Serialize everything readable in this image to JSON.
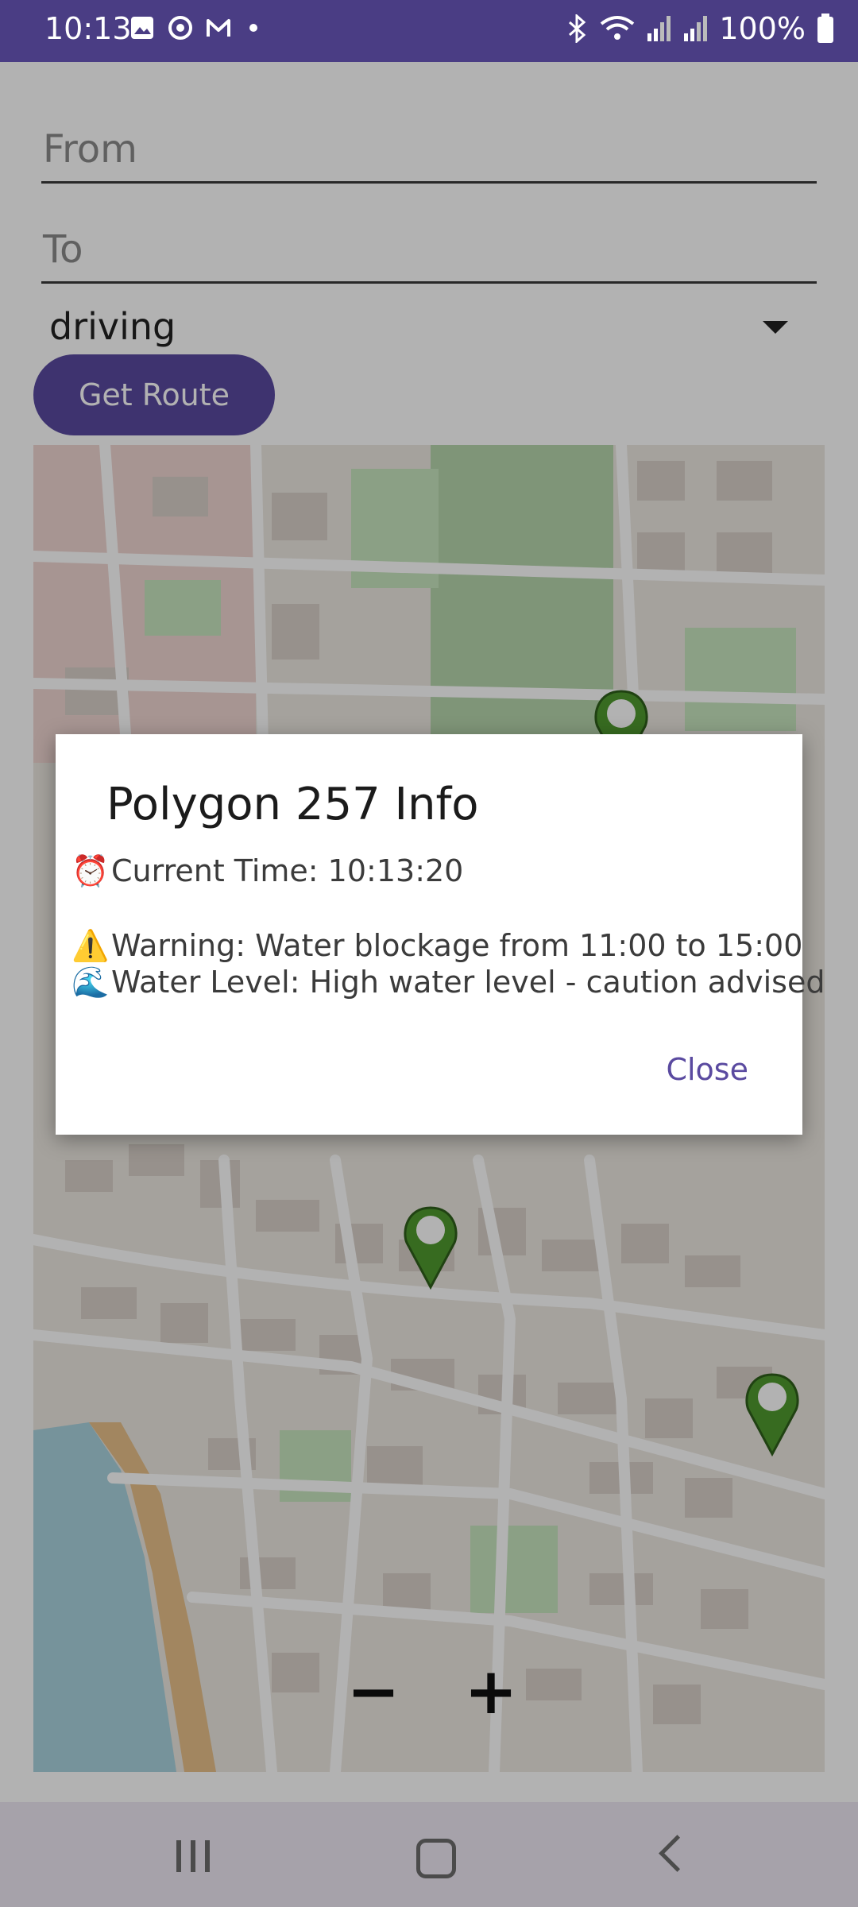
{
  "status_bar": {
    "time": "10:13",
    "battery": "100%",
    "left_icons": [
      "image-icon",
      "sync-icon",
      "gmail-icon",
      "dot-icon"
    ],
    "right_icons": [
      "bluetooth-icon",
      "wifi-icon",
      "signal-icon",
      "signal-icon-2",
      "battery-icon"
    ]
  },
  "form": {
    "from_placeholder": "From",
    "to_placeholder": "To",
    "mode_value": "driving",
    "route_button": "Get Route"
  },
  "map": {
    "zoom_out": "−",
    "zoom_in": "+",
    "markers": [
      "hand-pointer-marker",
      "hand-pointer-marker",
      "hand-pointer-marker"
    ]
  },
  "dialog": {
    "title": "Polygon 257 Info",
    "current_time_emoji": "⏰",
    "current_time": "Current Time: 10:13:20",
    "warning_emoji": "⚠️",
    "warning": "Warning: Water blockage from 11:00 to 15:00",
    "water_emoji": "🌊",
    "water_level": "Water Level: High water level - caution advised",
    "close": "Close"
  },
  "colors": {
    "status_bar": "#4a3d84",
    "accent": "#5a4aa0",
    "marker_green": "#4f9a2e"
  }
}
